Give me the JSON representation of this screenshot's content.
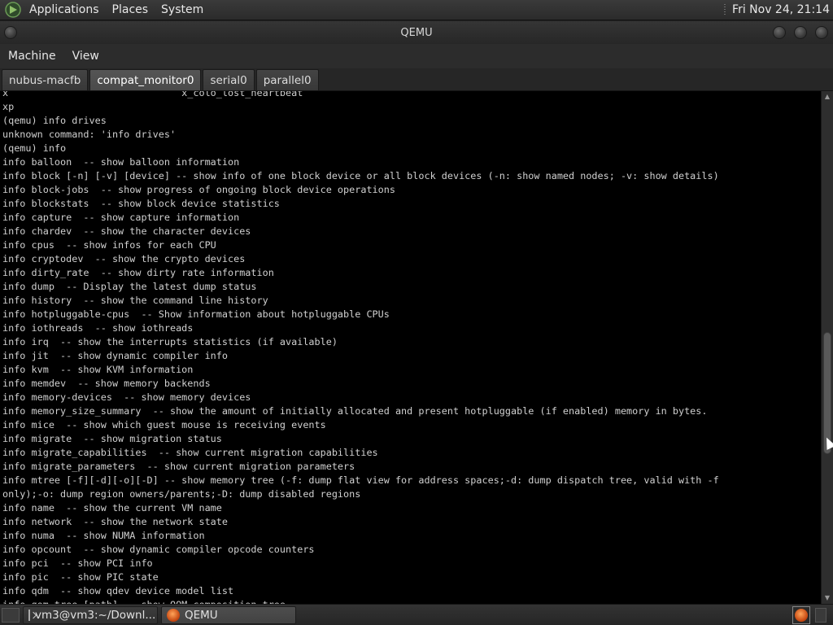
{
  "top_panel": {
    "menus": [
      "Applications",
      "Places",
      "System"
    ],
    "clock": "Fri Nov 24, 21:14"
  },
  "window": {
    "title": "QEMU"
  },
  "menubar": {
    "items": [
      "Machine",
      "View"
    ]
  },
  "tabs": {
    "items": [
      "nubus-macfb",
      "compat_monitor0",
      "serial0",
      "parallel0"
    ],
    "active": "compat_monitor0"
  },
  "terminal": {
    "lines": [
      "x                              x_colo_lost_heartbeat",
      "xp",
      "(qemu) info drives",
      "unknown command: 'info drives'",
      "(qemu) info",
      "info balloon  -- show balloon information",
      "info block [-n] [-v] [device] -- show info of one block device or all block devices (-n: show named nodes; -v: show details)",
      "info block-jobs  -- show progress of ongoing block device operations",
      "info blockstats  -- show block device statistics",
      "info capture  -- show capture information",
      "info chardev  -- show the character devices",
      "info cpus  -- show infos for each CPU",
      "info cryptodev  -- show the crypto devices",
      "info dirty_rate  -- show dirty rate information",
      "info dump  -- Display the latest dump status",
      "info history  -- show the command line history",
      "info hotpluggable-cpus  -- Show information about hotpluggable CPUs",
      "info iothreads  -- show iothreads",
      "info irq  -- show the interrupts statistics (if available)",
      "info jit  -- show dynamic compiler info",
      "info kvm  -- show KVM information",
      "info memdev  -- show memory backends",
      "info memory-devices  -- show memory devices",
      "info memory_size_summary  -- show the amount of initially allocated and present hotpluggable (if enabled) memory in bytes.",
      "info mice  -- show which guest mouse is receiving events",
      "info migrate  -- show migration status",
      "info migrate_capabilities  -- show current migration capabilities",
      "info migrate_parameters  -- show current migration parameters",
      "info mtree [-f][-d][-o][-D] -- show memory tree (-f: dump flat view for address spaces;-d: dump dispatch tree, valid with -f",
      "only);-o: dump region owners/parents;-D: dump disabled regions",
      "info name  -- show the current VM name",
      "info network  -- show the network state",
      "info numa  -- show NUMA information",
      "info opcount  -- show dynamic compiler opcode counters",
      "info pci  -- show PCI info",
      "info pic  -- show PIC state",
      "info qdm  -- show qdev device model list",
      "info qom-tree [path] -- show QOM composition tree"
    ]
  },
  "taskbar": {
    "tasks": [
      "vm3@vm3:~/Downl...",
      "QEMU"
    ],
    "active_task": "QEMU"
  }
}
